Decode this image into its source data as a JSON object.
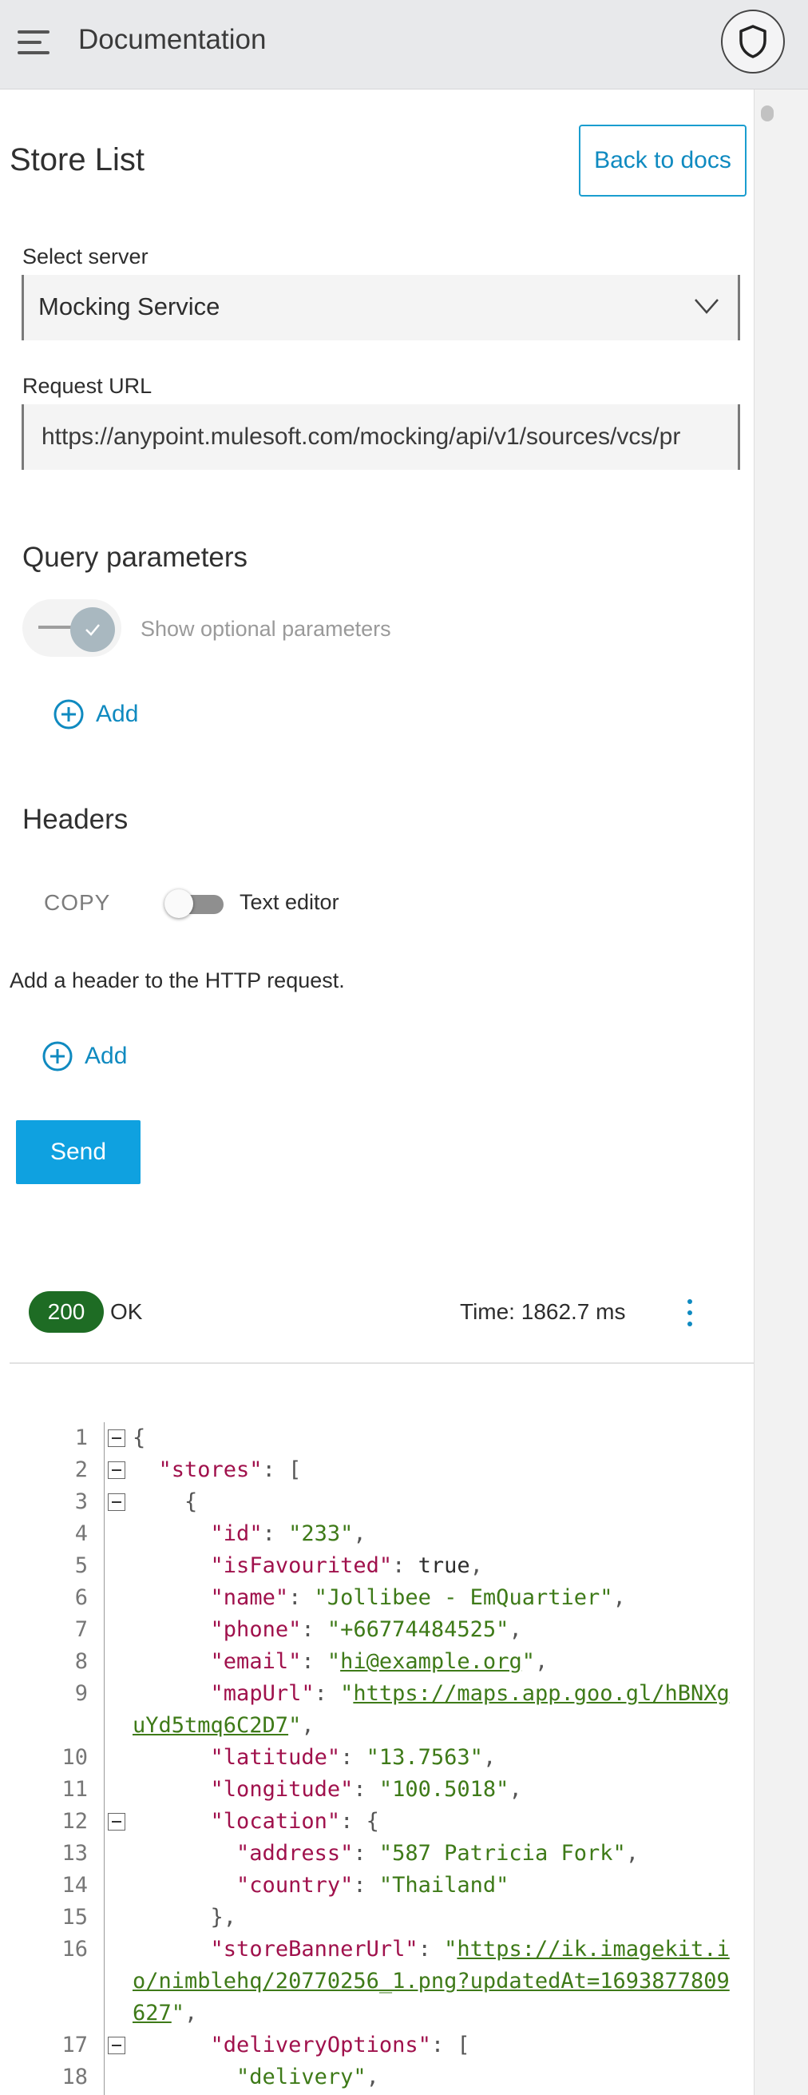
{
  "appbar": {
    "title": "Documentation",
    "menu_icon": "hamburger-menu-icon",
    "shield_icon": "shield-icon"
  },
  "page": {
    "title": "Store List",
    "back_label": "Back to docs"
  },
  "server": {
    "label": "Select server",
    "value": "Mocking Service"
  },
  "request": {
    "label": "Request URL",
    "url": "https://anypoint.mulesoft.com/mocking/api/v1/sources/vcs/pr"
  },
  "query": {
    "title": "Query parameters",
    "optional_label": "Show optional parameters",
    "add_label": "Add"
  },
  "headers": {
    "title": "Headers",
    "copy_label": "COPY",
    "text_editor_label": "Text editor",
    "hint": "Add a header to the HTTP request.",
    "add_label": "Add"
  },
  "send_label": "Send",
  "response": {
    "status_code": "200",
    "status_text": "OK",
    "time": "Time: 1862.7 ms",
    "colors": {
      "status_badge": "#1e6c24",
      "accent": "#0fa1e0"
    }
  },
  "code": {
    "line_numbers": [
      "1",
      "2",
      "3",
      "4",
      "5",
      "6",
      "7",
      "8",
      "9",
      "10",
      "11",
      "12",
      "13",
      "14",
      "15",
      "16",
      "17",
      "18"
    ],
    "l1": "{",
    "l2_key": "\"stores\"",
    "l3": "{",
    "l4_key": "\"id\"",
    "l4_val": "\"233\"",
    "l5_key": "\"isFavourited\"",
    "l5_val": "true",
    "l6_key": "\"name\"",
    "l6_val": "\"Jollibee - EmQuartier\"",
    "l7_key": "\"phone\"",
    "l7_val": "\"+66774484525\"",
    "l8_key": "\"email\"",
    "l8_val": "hi@example.org",
    "l9_key": "\"mapUrl\"",
    "l9_url_a": "https://maps.app.goo.gl/hBNXg",
    "l9_url_b": "uYd5tmq6C2D7",
    "l10_key": "\"latitude\"",
    "l10_val": "\"13.7563\"",
    "l11_key": "\"longitude\"",
    "l11_val": "\"100.5018\"",
    "l12_key": "\"location\"",
    "l13_key": "\"address\"",
    "l13_val": "\"587 Patricia Fork\"",
    "l14_key": "\"country\"",
    "l14_val": "\"Thailand\"",
    "l15": "},",
    "l16_key": "\"storeBannerUrl\"",
    "l16_url_a": "https://ik.imagekit.i",
    "l16_url_b": "o/nimblehq/20770256_1.png?updatedAt=1693877809",
    "l16_url_c": "627",
    "l17_key": "\"deliveryOptions\"",
    "l18_val": "\"delivery\""
  }
}
